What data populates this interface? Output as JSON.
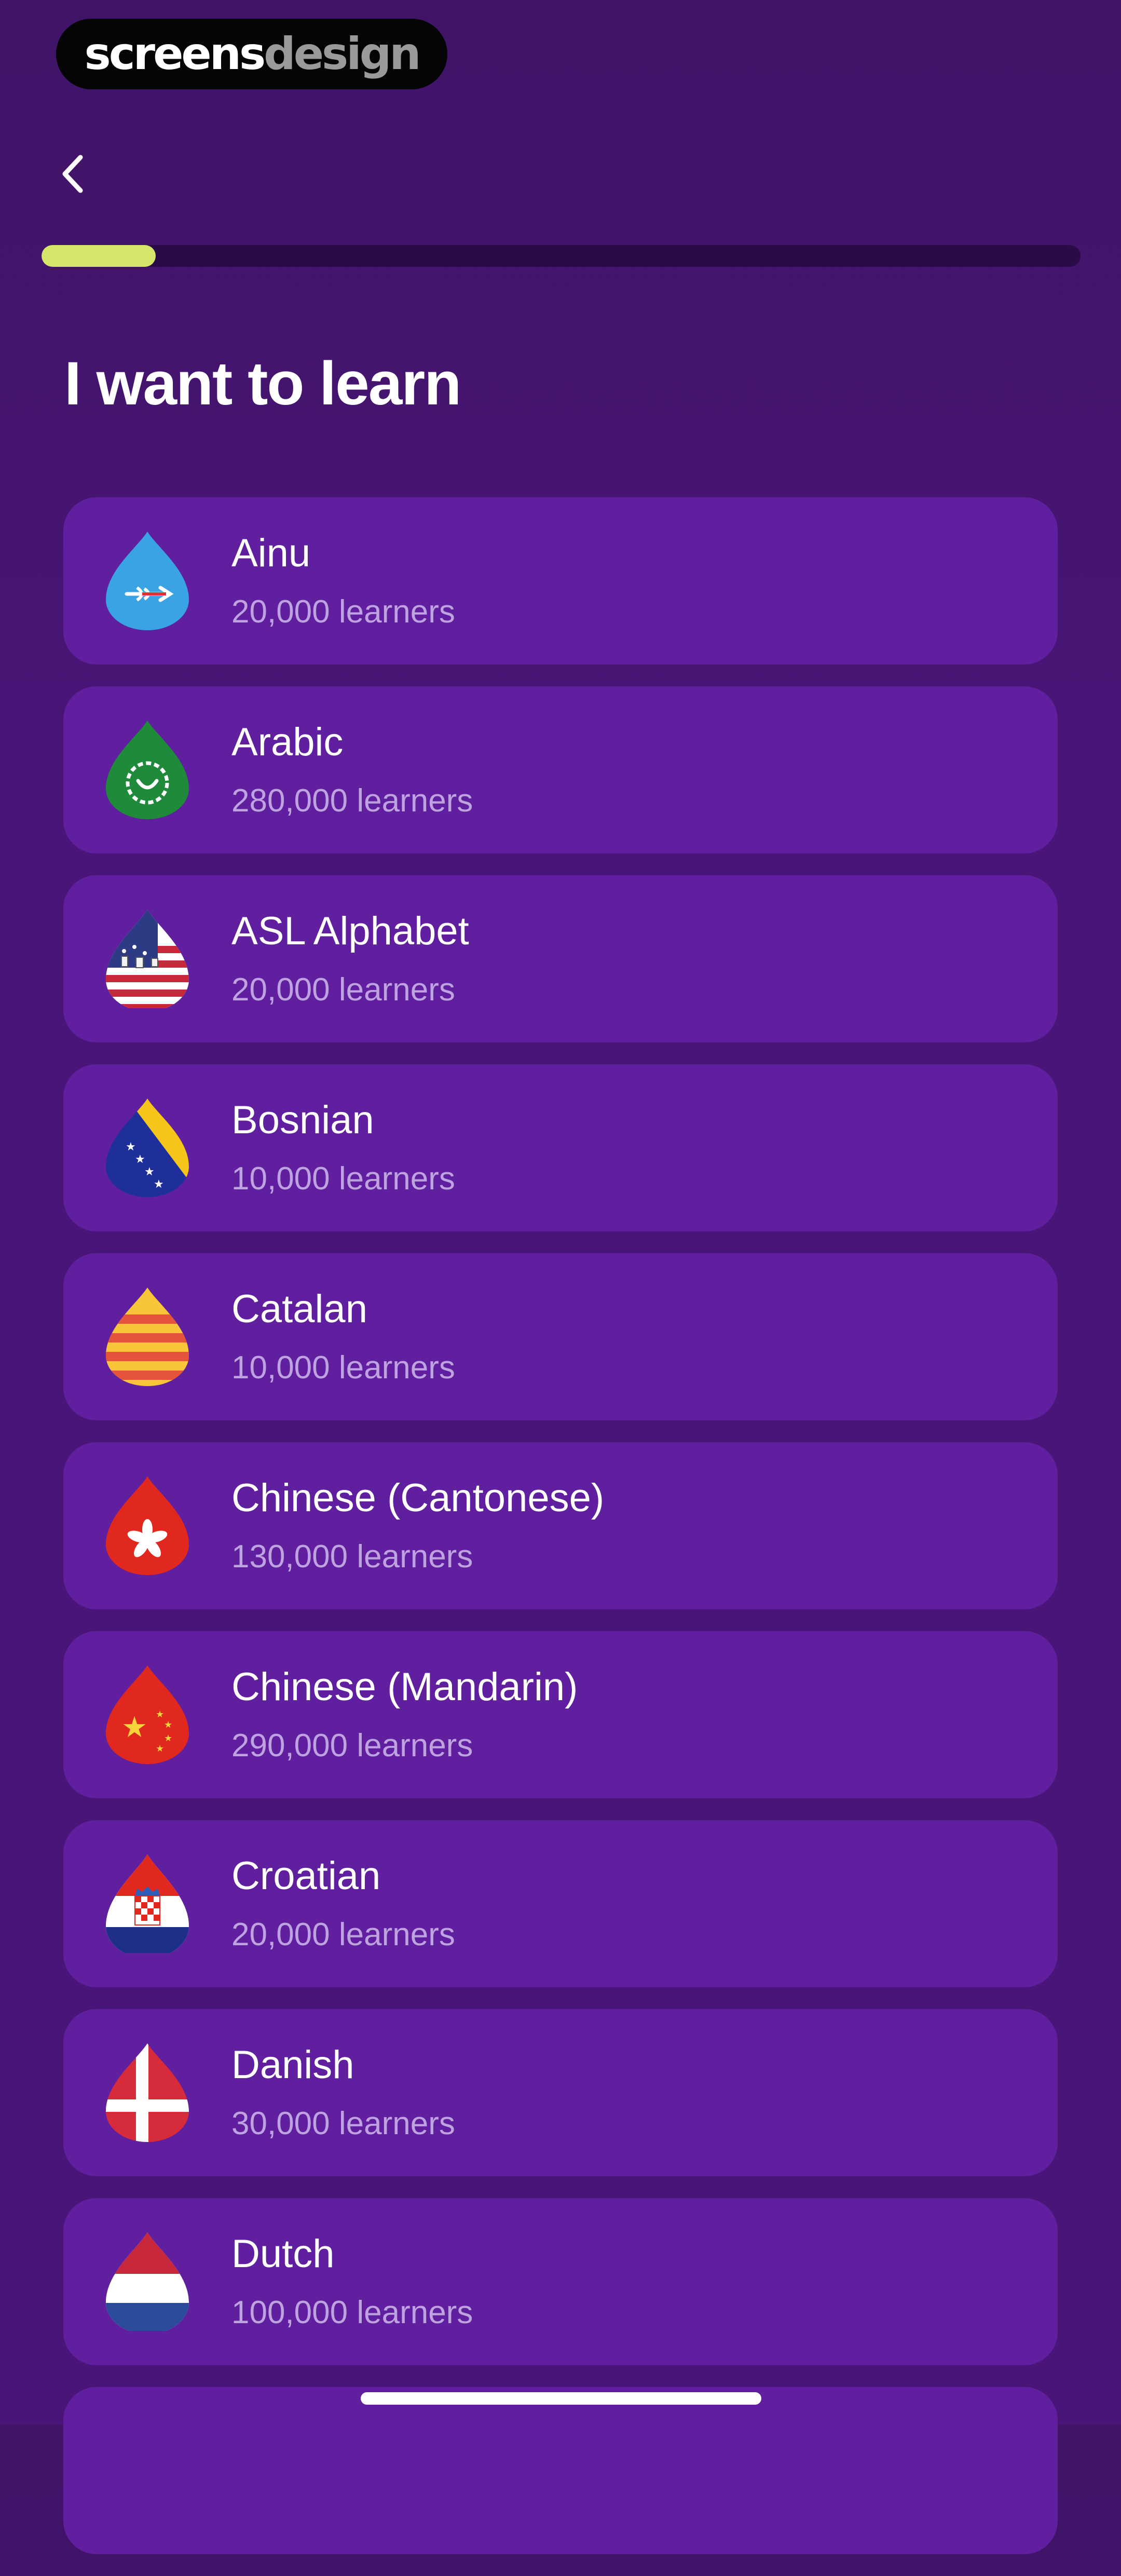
{
  "watermark": {
    "part1": "screens",
    "part2": "design"
  },
  "header": {
    "back_icon": "chevron-left-icon",
    "progress_fraction": 0.11
  },
  "page": {
    "title": "I want to learn"
  },
  "languages": [
    {
      "name": "Ainu",
      "learners": "20,000 learners",
      "icon": "ainu-flag-icon"
    },
    {
      "name": "Arabic",
      "learners": "280,000 learners",
      "icon": "arabic-flag-icon"
    },
    {
      "name": "ASL Alphabet",
      "learners": "20,000 learners",
      "icon": "asl-flag-icon"
    },
    {
      "name": "Bosnian",
      "learners": "10,000 learners",
      "icon": "bosnian-flag-icon"
    },
    {
      "name": "Catalan",
      "learners": "10,000 learners",
      "icon": "catalan-flag-icon"
    },
    {
      "name": "Chinese (Cantonese)",
      "learners": "130,000 learners",
      "icon": "hong-kong-flag-icon"
    },
    {
      "name": "Chinese (Mandarin)",
      "learners": "290,000 learners",
      "icon": "china-flag-icon"
    },
    {
      "name": "Croatian",
      "learners": "20,000 learners",
      "icon": "croatian-flag-icon"
    },
    {
      "name": "Danish",
      "learners": "30,000 learners",
      "icon": "danish-flag-icon"
    },
    {
      "name": "Dutch",
      "learners": "100,000 learners",
      "icon": "dutch-flag-icon"
    }
  ],
  "colors": {
    "background": "#4a1579",
    "card": "#5f1f9e",
    "progress_fill": "#d6e66a",
    "learners_text": "#bfa2e0"
  }
}
